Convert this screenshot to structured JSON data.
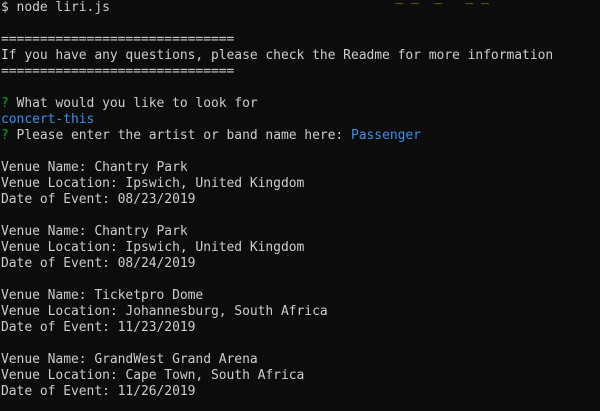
{
  "terminal": {
    "command": "$ node liri.js",
    "separator": "==============================",
    "help_text": "If you have any questions, please check the Readme for more information",
    "question_mark": "?",
    "question_1": " What would you like to look for",
    "answer_1": "concert-this",
    "question_2": " Please enter the artist or band name here: ",
    "answer_2": "Passenger",
    "events": [
      {
        "venue_name": "Venue Name: Chantry Park",
        "venue_location": "Venue Location: Ipswich, United Kingdom",
        "date": "Date of Event: 08/23/2019"
      },
      {
        "venue_name": "Venue Name: Chantry Park",
        "venue_location": "Venue Location: Ipswich, United Kingdom",
        "date": "Date of Event: 08/24/2019"
      },
      {
        "venue_name": "Venue Name: Ticketpro Dome",
        "venue_location": "Venue Location: Johannesburg, South Africa",
        "date": "Date of Event: 11/23/2019"
      },
      {
        "venue_name": "Venue Name: GrandWest Grand Arena",
        "venue_location": "Venue Location: Cape Town, South Africa",
        "date": "Date of Event: 11/26/2019"
      }
    ],
    "colors": {
      "background": "#0c0c0c",
      "text": "#cccccc",
      "prompt_mark": "#13a10e",
      "answer": "#3b8eea"
    }
  }
}
